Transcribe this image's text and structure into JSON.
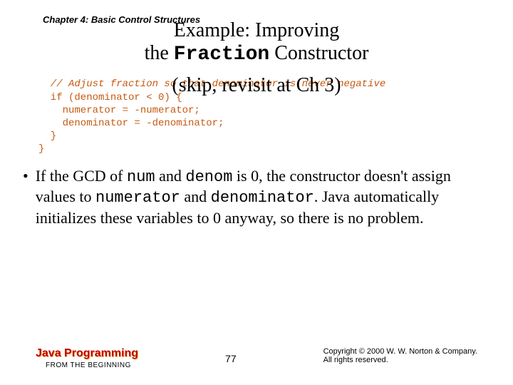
{
  "header": {
    "chapter": "Chapter 4: Basic Control Structures"
  },
  "title": {
    "line1_pre": "Example: Improving",
    "line2_pre": "the ",
    "line2_mono": "Fraction",
    "line2_post": " Constructor",
    "annotation": "(skip, revisit at Ch 3)"
  },
  "code": {
    "c1": "  // Adjust fraction so that denominator is never negative",
    "c2": "  if (denominator < 0) {",
    "c3": "    numerator = -numerator;",
    "c4": "    denominator = -denominator;",
    "c5": "  }",
    "c6": "}"
  },
  "bullet": {
    "marker": "•",
    "p1": "If the GCD of ",
    "m1": "num",
    "p2": " and ",
    "m2": "denom",
    "p3": " is 0, the constructor doesn't assign values to ",
    "m3": "numerator",
    "p4": " and ",
    "m4": "denominator",
    "p5": ". Java automatically initializes these variables to 0 anyway, so there is no problem."
  },
  "footer": {
    "book_title": "Java Programming",
    "book_subtitle": "FROM THE BEGINNING",
    "page": "77",
    "copyright_l1": "Copyright © 2000 W. W. Norton & Company.",
    "copyright_l2": "All rights reserved."
  }
}
